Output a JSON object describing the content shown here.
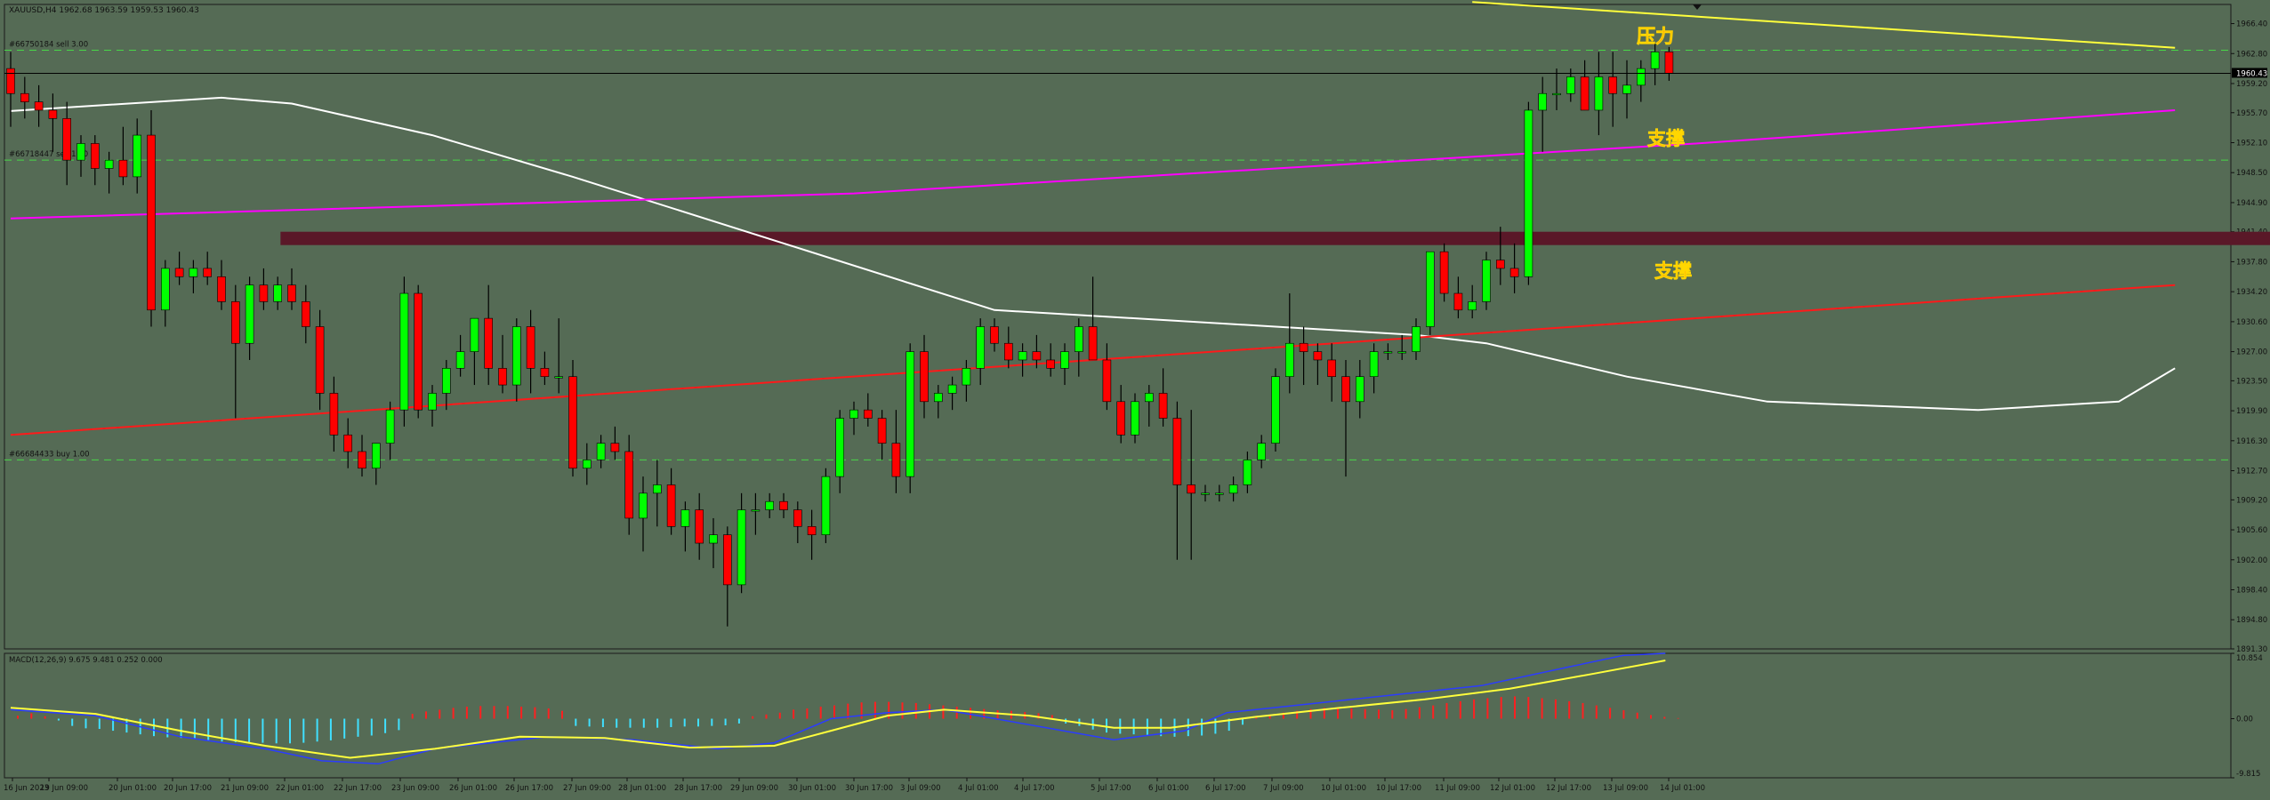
{
  "header": {
    "symbol_line": "XAUUSD,H4  1962.68 1963.59 1959.53 1960.43"
  },
  "orders": [
    {
      "label": "#66750184 sell 3.00",
      "price": 1963.2
    },
    {
      "label": "#66718447 sell 1.00",
      "price": 1950.0
    },
    {
      "label": "#66684433 buy 1.00",
      "price": 1914.0
    }
  ],
  "annotations": [
    {
      "text": "压力",
      "color": "#ff5a1f"
    },
    {
      "text": "支撑",
      "color": "#ff5a1f"
    },
    {
      "text": "支撑",
      "color": "#ff5a1f"
    }
  ],
  "current_price_label": "1960.43",
  "macd": {
    "label": "MACD(12,26,9) 9.675 9.481 0.252 0.000",
    "axis_ticks": [
      "10.854",
      "0.00",
      "-9.815"
    ]
  },
  "chart_data": {
    "type": "candlestick",
    "symbol": "XAUUSD",
    "timeframe": "H4",
    "ylim": [
      1891.3,
      1968.7
    ],
    "y_ticks": [
      1966.4,
      1962.8,
      1959.2,
      1955.7,
      1952.1,
      1948.5,
      1944.9,
      1941.4,
      1937.8,
      1934.2,
      1930.6,
      1927.0,
      1923.5,
      1919.9,
      1916.3,
      1912.7,
      1909.2,
      1905.6,
      1902.0,
      1898.4,
      1894.8,
      1891.3
    ],
    "x_ticks": [
      "16 Jun 2023",
      "19 Jun 09:00",
      "20 Jun 01:00",
      "20 Jun 17:00",
      "21 Jun 09:00",
      "22 Jun 01:00",
      "22 Jun 17:00",
      "23 Jun 09:00",
      "26 Jun 01:00",
      "26 Jun 17:00",
      "27 Jun 09:00",
      "28 Jun 01:00",
      "28 Jun 17:00",
      "29 Jun 09:00",
      "30 Jun 01:00",
      "30 Jun 17:00",
      "3 Jul 09:00",
      "4 Jul 01:00",
      "4 Jul 17:00",
      "5 Jul 17:00",
      "6 Jul 01:00",
      "6 Jul 17:00",
      "7 Jul 09:00",
      "10 Jul 01:00",
      "10 Jul 17:00",
      "11 Jul 09:00",
      "12 Jul 01:00",
      "12 Jul 17:00",
      "13 Jul 09:00",
      "14 Jul 01:00"
    ],
    "candles": [
      [
        1961,
        1963,
        1954,
        1958
      ],
      [
        1958,
        1960,
        1955,
        1957
      ],
      [
        1957,
        1959,
        1954,
        1956
      ],
      [
        1956,
        1958,
        1951,
        1955
      ],
      [
        1955,
        1957,
        1947,
        1950
      ],
      [
        1950,
        1953,
        1948,
        1952
      ],
      [
        1952,
        1953,
        1947,
        1949
      ],
      [
        1949,
        1951,
        1946,
        1950
      ],
      [
        1950,
        1954,
        1947,
        1948
      ],
      [
        1948,
        1955,
        1946,
        1953
      ],
      [
        1953,
        1956,
        1930,
        1932
      ],
      [
        1932,
        1938,
        1930,
        1937
      ],
      [
        1937,
        1939,
        1935,
        1936
      ],
      [
        1936,
        1938,
        1934,
        1937
      ],
      [
        1937,
        1939,
        1935,
        1936
      ],
      [
        1936,
        1938,
        1932,
        1933
      ],
      [
        1933,
        1935,
        1919,
        1928
      ],
      [
        1928,
        1936,
        1926,
        1935
      ],
      [
        1935,
        1937,
        1932,
        1933
      ],
      [
        1933,
        1936,
        1932,
        1935
      ],
      [
        1935,
        1937,
        1932,
        1933
      ],
      [
        1933,
        1935,
        1928,
        1930
      ],
      [
        1930,
        1932,
        1920,
        1922
      ],
      [
        1922,
        1924,
        1915,
        1917
      ],
      [
        1917,
        1919,
        1913,
        1915
      ],
      [
        1915,
        1917,
        1912,
        1913
      ],
      [
        1913,
        1916,
        1911,
        1916
      ],
      [
        1916,
        1921,
        1914,
        1920
      ],
      [
        1920,
        1936,
        1918,
        1934
      ],
      [
        1934,
        1935,
        1919,
        1920
      ],
      [
        1920,
        1923,
        1918,
        1922
      ],
      [
        1922,
        1926,
        1920,
        1925
      ],
      [
        1925,
        1929,
        1924,
        1927
      ],
      [
        1927,
        1931,
        1923,
        1931
      ],
      [
        1931,
        1935,
        1923,
        1925
      ],
      [
        1925,
        1929,
        1922,
        1923
      ],
      [
        1923,
        1931,
        1921,
        1930
      ],
      [
        1930,
        1932,
        1922,
        1925
      ],
      [
        1925,
        1927,
        1923,
        1924
      ],
      [
        1924,
        1931,
        1922,
        1924
      ],
      [
        1924,
        1926,
        1912,
        1913
      ],
      [
        1913,
        1916,
        1911,
        1914
      ],
      [
        1914,
        1917,
        1913,
        1916
      ],
      [
        1916,
        1918,
        1914,
        1915
      ],
      [
        1915,
        1917,
        1905,
        1907
      ],
      [
        1907,
        1912,
        1903,
        1910
      ],
      [
        1910,
        1914,
        1906,
        1911
      ],
      [
        1911,
        1913,
        1905,
        1906
      ],
      [
        1906,
        1909,
        1903,
        1908
      ],
      [
        1908,
        1910,
        1902,
        1904
      ],
      [
        1904,
        1907,
        1901,
        1905
      ],
      [
        1905,
        1906,
        1894,
        1899
      ],
      [
        1899,
        1910,
        1898,
        1908
      ],
      [
        1908,
        1910,
        1905,
        1908
      ],
      [
        1908,
        1910,
        1907,
        1909
      ],
      [
        1909,
        1910,
        1907,
        1908
      ],
      [
        1908,
        1909,
        1904,
        1906
      ],
      [
        1906,
        1908,
        1902,
        1905
      ],
      [
        1905,
        1913,
        1904,
        1912
      ],
      [
        1912,
        1920,
        1910,
        1919
      ],
      [
        1919,
        1921,
        1917,
        1920
      ],
      [
        1920,
        1922,
        1918,
        1919
      ],
      [
        1919,
        1920,
        1914,
        1916
      ],
      [
        1916,
        1920,
        1910,
        1912
      ],
      [
        1912,
        1928,
        1910,
        1927
      ],
      [
        1927,
        1929,
        1919,
        1921
      ],
      [
        1921,
        1923,
        1919,
        1922
      ],
      [
        1922,
        1924,
        1920,
        1923
      ],
      [
        1923,
        1926,
        1921,
        1925
      ],
      [
        1925,
        1931,
        1923,
        1930
      ],
      [
        1930,
        1931,
        1927,
        1928
      ],
      [
        1928,
        1930,
        1925,
        1926
      ],
      [
        1926,
        1928,
        1924,
        1927
      ],
      [
        1927,
        1929,
        1925,
        1926
      ],
      [
        1926,
        1928,
        1924,
        1925
      ],
      [
        1925,
        1928,
        1923,
        1927
      ],
      [
        1927,
        1931,
        1924,
        1930
      ],
      [
        1930,
        1936,
        1926,
        1926
      ],
      [
        1926,
        1928,
        1920,
        1921
      ],
      [
        1921,
        1923,
        1916,
        1917
      ],
      [
        1917,
        1922,
        1916,
        1921
      ],
      [
        1921,
        1923,
        1918,
        1922
      ],
      [
        1922,
        1925,
        1918,
        1919
      ],
      [
        1919,
        1921,
        1902,
        1911
      ],
      [
        1911,
        1920,
        1902,
        1910
      ],
      [
        1910,
        1911,
        1909,
        1910
      ],
      [
        1910,
        1911,
        1909,
        1910
      ],
      [
        1910,
        1912,
        1909,
        1911
      ],
      [
        1911,
        1915,
        1910,
        1914
      ],
      [
        1914,
        1917,
        1913,
        1916
      ],
      [
        1916,
        1925,
        1915,
        1924
      ],
      [
        1924,
        1934,
        1922,
        1928
      ],
      [
        1928,
        1930,
        1923,
        1927
      ],
      [
        1927,
        1928,
        1923,
        1926
      ],
      [
        1926,
        1928,
        1921,
        1924
      ],
      [
        1924,
        1926,
        1912,
        1921
      ],
      [
        1921,
        1926,
        1919,
        1924
      ],
      [
        1924,
        1928,
        1922,
        1927
      ],
      [
        1927,
        1928,
        1926,
        1927
      ],
      [
        1927,
        1929,
        1926,
        1927
      ],
      [
        1927,
        1931,
        1926,
        1930
      ],
      [
        1930,
        1939,
        1929,
        1939
      ],
      [
        1939,
        1940,
        1933,
        1934
      ],
      [
        1934,
        1936,
        1931,
        1932
      ],
      [
        1932,
        1935,
        1931,
        1933
      ],
      [
        1933,
        1939,
        1932,
        1938
      ],
      [
        1938,
        1942,
        1935,
        1937
      ],
      [
        1937,
        1940,
        1934,
        1936
      ],
      [
        1936,
        1957,
        1935,
        1956
      ],
      [
        1956,
        1960,
        1951,
        1958
      ],
      [
        1958,
        1961,
        1956,
        1958
      ],
      [
        1958,
        1961,
        1957,
        1960
      ],
      [
        1960,
        1962,
        1956,
        1956
      ],
      [
        1956,
        1963,
        1953,
        1960
      ],
      [
        1960,
        1963,
        1954,
        1958
      ],
      [
        1958,
        1962,
        1955,
        1959
      ],
      [
        1959,
        1962,
        1957,
        1961
      ],
      [
        1961,
        1964,
        1959,
        1963
      ],
      [
        1963,
        1963.59,
        1959.53,
        1960.43
      ]
    ],
    "lines": [
      {
        "color": "#ffffff",
        "points": [
          [
            0,
            1955.9
          ],
          [
            15,
            1957.5
          ],
          [
            20,
            1956.8
          ],
          [
            30,
            1953
          ],
          [
            40,
            1948
          ],
          [
            55,
            1940
          ],
          [
            70,
            1932
          ],
          [
            90,
            1930
          ],
          [
            100,
            1929
          ],
          [
            105,
            1928
          ],
          [
            115,
            1924
          ],
          [
            125,
            1921
          ],
          [
            140,
            1920
          ],
          [
            150,
            1921
          ],
          [
            154,
            1925
          ]
        ]
      },
      {
        "color": "#ff00ff",
        "points": [
          [
            0,
            1943
          ],
          [
            60,
            1946
          ],
          [
            120,
            1952
          ],
          [
            154,
            1956
          ]
        ]
      },
      {
        "color": "#ff1a1a",
        "points": [
          [
            0,
            1917
          ],
          [
            154,
            1935
          ]
        ]
      },
      {
        "color": "#ffff3c",
        "points": [
          [
            104,
            1969
          ],
          [
            154,
            1963.5
          ]
        ]
      }
    ],
    "zone": {
      "price_low": 1939.8,
      "price_high": 1941.4,
      "index_start": 19.2,
      "index_end": 186.5,
      "color": "#5a1828"
    },
    "macd_ylim": [
      -9.815,
      10.854
    ],
    "macd_hist": [
      0.5,
      0.9,
      0.4,
      -0.3,
      -1.2,
      -1.6,
      -1.7,
      -2.0,
      -2.3,
      -2.6,
      -2.9,
      -3.1,
      -3.2,
      -3.4,
      -3.6,
      -3.8,
      -3.9,
      -4.0,
      -4.0,
      -4.1,
      -4.1,
      -4.0,
      -3.8,
      -3.6,
      -3.3,
      -3.0,
      -2.8,
      -2.4,
      -1.9,
      0.8,
      1.2,
      1.5,
      1.8,
      2.0,
      2.1,
      2.1,
      2.1,
      2.0,
      1.9,
      1.7,
      1.3,
      -1.2,
      -1.3,
      -1.4,
      -1.5,
      -1.5,
      -1.5,
      -1.5,
      -1.4,
      -1.3,
      -1.3,
      -1.2,
      -1.1,
      -0.8,
      0.4,
      0.7,
      1.0,
      1.5,
      1.7,
      2.0,
      2.2,
      2.5,
      2.7,
      2.8,
      2.8,
      2.7,
      2.6,
      2.4,
      2.2,
      2.0,
      1.8,
      1.6,
      1.4,
      1.3,
      1.1,
      0.9,
      0.6,
      -0.8,
      -1.2,
      -1.8,
      -2.3,
      -2.5,
      -2.6,
      -2.8,
      -2.9,
      -3.0,
      -2.9,
      -2.8,
      -2.5,
      -2.0,
      -1.0,
      0.2,
      0.6,
      1.0,
      1.3,
      1.6,
      1.8,
      1.8,
      1.7,
      1.6,
      1.5,
      1.4,
      1.6,
      1.9,
      2.2,
      2.6,
      2.9,
      3.2,
      3.4,
      3.6,
      3.7,
      3.6,
      3.4,
      3.2,
      2.9,
      2.6,
      2.2,
      1.8,
      1.4,
      1.0,
      0.6,
      0.3,
      0.1
    ],
    "macd_main": [
      [
        0,
        1.5
      ],
      [
        6,
        0.5
      ],
      [
        12,
        -3
      ],
      [
        18,
        -5
      ],
      [
        22,
        -7
      ],
      [
        26,
        -7.5
      ],
      [
        30,
        -5
      ],
      [
        38,
        -3
      ],
      [
        44,
        -3.5
      ],
      [
        50,
        -5
      ],
      [
        54,
        -4
      ],
      [
        58,
        0
      ],
      [
        62,
        1
      ],
      [
        66,
        1.5
      ],
      [
        72,
        -1
      ],
      [
        78,
        -3.5
      ],
      [
        83,
        -2
      ],
      [
        86,
        1
      ],
      [
        92,
        2.5
      ],
      [
        98,
        4
      ],
      [
        104,
        5.5
      ],
      [
        110,
        8.5
      ],
      [
        114,
        10.5
      ],
      [
        117,
        10.854
      ]
    ],
    "macd_signal": [
      [
        0,
        1.8
      ],
      [
        6,
        0.8
      ],
      [
        12,
        -2
      ],
      [
        18,
        -4.5
      ],
      [
        24,
        -6.5
      ],
      [
        30,
        -5
      ],
      [
        36,
        -3
      ],
      [
        42,
        -3.2
      ],
      [
        48,
        -4.8
      ],
      [
        54,
        -4.5
      ],
      [
        58,
        -2
      ],
      [
        62,
        0.5
      ],
      [
        66,
        1.5
      ],
      [
        72,
        0.5
      ],
      [
        78,
        -1.5
      ],
      [
        82,
        -1.5
      ],
      [
        88,
        0.3
      ],
      [
        94,
        1.8
      ],
      [
        100,
        3.2
      ],
      [
        106,
        5
      ],
      [
        112,
        7.5
      ],
      [
        117,
        9.675
      ]
    ]
  }
}
